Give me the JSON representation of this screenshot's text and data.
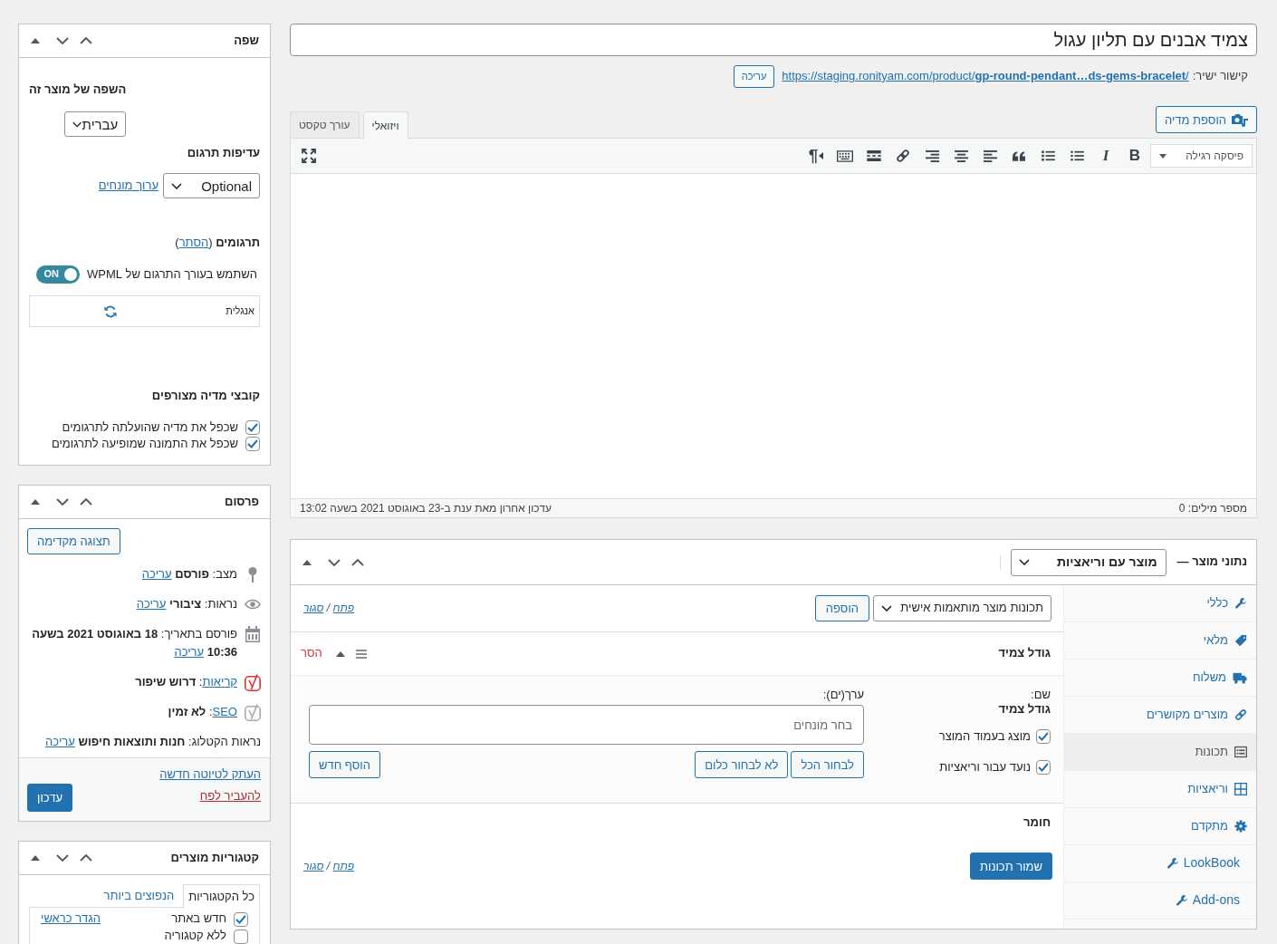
{
  "title_field": {
    "value": "צמיד אבנים עם תליון עגול"
  },
  "permalink": {
    "label": "קישור ישיר:",
    "url": "https://staging.ronityam.com/product/**gp-round-pendant…ds-gems-bracelet**/",
    "edit_button": "עריכה"
  },
  "editor": {
    "add_media_button": "הוספת מדיה",
    "tabs": [
      {
        "label": "ויזואלי",
        "selected": true
      },
      {
        "label": "עורך טקסט",
        "selected": false
      }
    ],
    "format_select": "פיסקה רגילה",
    "bold_button": "B",
    "italic_button": "I",
    "direction_button": "¶",
    "word_count": "מספר מילים: 0",
    "last_edit": "עדכון אחרון מאת ענת ב-23 באוגוסט 2021 בשעה 13:02"
  },
  "product_data": {
    "title": "נתוני מוצר —",
    "type_select": "מוצר עם וריאציות",
    "tabs": [
      {
        "label": "כללי",
        "kind": "general",
        "selected": false
      },
      {
        "label": "מלאי",
        "kind": "inventory",
        "selected": false
      },
      {
        "label": "משלוח",
        "kind": "shipping",
        "selected": false
      },
      {
        "label": "מוצרים מקושרים",
        "kind": "linked",
        "selected": false
      },
      {
        "label": "תכונות",
        "kind": "attributes",
        "selected": true
      },
      {
        "label": "וריאציות",
        "kind": "variations",
        "selected": false
      },
      {
        "label": "מתקדם",
        "kind": "advanced",
        "selected": false
      },
      {
        "label": "LookBook",
        "kind": "plugin",
        "selected": false
      },
      {
        "label": "Add-ons",
        "kind": "plugin",
        "selected": false
      }
    ],
    "attribute_select": "תכונות מוצר מותאמות אישית",
    "add_button": "הוספה",
    "expand_links": {
      "expand": "פתח",
      "separator": "/",
      "collapse": "סגור"
    },
    "attributes": [
      {
        "name": "גודל צמיד",
        "expanded": true,
        "remove_link": "הסר",
        "name_label": "שם:",
        "name_value": "גודל צמיד",
        "options": [
          {
            "label": "מוצג בעמוד המוצר",
            "checked": true
          },
          {
            "label": "נועד עבור וריאציות",
            "checked": true
          }
        ],
        "values_label": "ערך(ים):",
        "values_placeholder": "בחר מונחים",
        "select_all_button": "לבחור הכל",
        "select_none_button": "לא לבחור כלום",
        "add_new_button": "הוסף חדש"
      },
      {
        "name": "חומר",
        "expanded": false
      }
    ],
    "save_button": "שמור תכונות",
    "footer_links": {
      "expand": "פתח",
      "separator": "/",
      "collapse": "סגור"
    }
  },
  "language_box": {
    "title": "שפה",
    "product_language_label": "השפה של מוצר זה",
    "language_select": "עברית",
    "priority_label": "עדיפות תרגום",
    "priority_select": "Optional",
    "edit_terms_link": "ערוך מונחים",
    "translations": {
      "label": "תרגומים",
      "open_paren": "(",
      "link": "הסתר",
      "close_paren": ")"
    },
    "editor_toggle": {
      "label": "השתמש בעורך התרגום של WPML",
      "on": true,
      "on_text": "ON"
    },
    "translation_rows": [
      {
        "language": "אנגלית"
      }
    ],
    "media_label": "קובצי מדיה מצורפים",
    "media_options": [
      {
        "label": "שכפל את מדיה שהועלתה לתרגומים",
        "checked": true
      },
      {
        "label": "שכפל את התמונה שמופיעה לתרגומים",
        "checked": true
      }
    ]
  },
  "publish_box": {
    "title": "פרסום",
    "preview_button": "תצוגה מקדימה",
    "rows": [
      {
        "kind": "status",
        "label": "מצב:",
        "value": "פורסם",
        "link": "עריכה"
      },
      {
        "kind": "visibility",
        "label": "נראות:",
        "value": "ציבורי",
        "link": "עריכה"
      },
      {
        "kind": "date",
        "label": "פורסם בתאריך:",
        "value": "18 באוגוסט 2021 בשעה 10:36",
        "link": "עריכה"
      },
      {
        "kind": "readability",
        "label_link": "קריאות",
        "label": ":",
        "value": "דרוש שיפור",
        "color": "#dc3232"
      },
      {
        "kind": "seo",
        "label_link": "SEO",
        "label": ":",
        "value": "לא זמין",
        "color": "#a7aaad"
      },
      {
        "kind": "catalog",
        "label": "נראות הקטלוג:",
        "value": "חנות ותוצאות חיפוש",
        "link": "עריכה"
      }
    ],
    "copy_link": "העתק לטיוטה חדשה",
    "trash_link": "להעביר לפח",
    "update_button": "עדכון"
  },
  "categories_box": {
    "title": "קטגוריות מוצרים",
    "tabs": [
      {
        "label": "כל הקטגוריות",
        "selected": true
      },
      {
        "label": "הנפוצים ביותר",
        "selected": false
      }
    ],
    "items": [
      {
        "label": "חדש באתר",
        "checked": true,
        "primary_link": "הגדר כראשי"
      },
      {
        "label": "ללא קטגוריה",
        "checked": false
      }
    ]
  }
}
